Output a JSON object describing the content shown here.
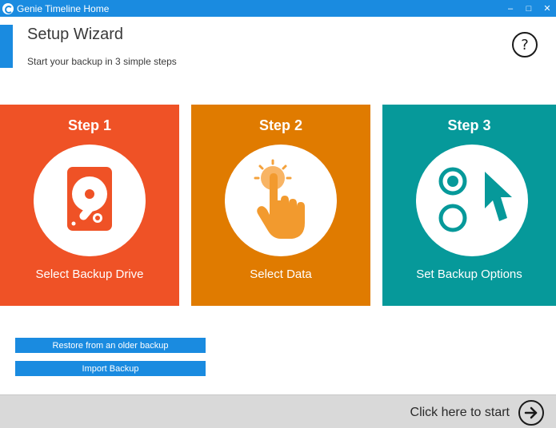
{
  "window": {
    "title": "Genie Timeline Home",
    "controls": [
      "minimize-icon",
      "maximize-icon",
      "close-icon"
    ],
    "accent_color": "#1a8be0"
  },
  "header": {
    "title": "Setup Wizard",
    "subtitle": "Start your backup in 3 simple steps",
    "help_label": "?"
  },
  "steps": [
    {
      "title": "Step 1",
      "label": "Select Backup Drive",
      "icon": "hard-drive-icon",
      "color": "#ef5226"
    },
    {
      "title": "Step 2",
      "label": "Select Data",
      "icon": "touch-hand-icon",
      "color": "#e07b00"
    },
    {
      "title": "Step 3",
      "label": "Set Backup Options",
      "icon": "options-cursor-icon",
      "color": "#06999a"
    }
  ],
  "actions": {
    "restore_label": "Restore from an older backup",
    "import_label": "Import Backup"
  },
  "footer": {
    "start_label": "Click here to start",
    "start_icon": "arrow-right-circle-icon"
  }
}
